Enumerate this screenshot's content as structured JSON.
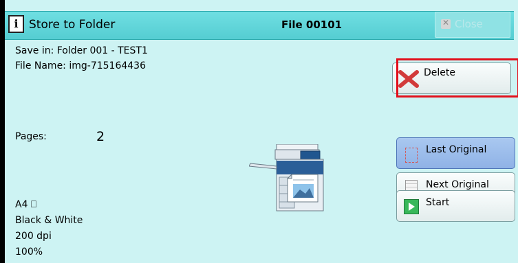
{
  "header": {
    "title": "Store to Folder",
    "file_number": "File 00101",
    "close_label": "Close"
  },
  "info": {
    "save_in": "Save in: Folder 001 - TEST1",
    "file_name": "File Name: img-715164436",
    "pages_label": "Pages:",
    "pages_value": "2"
  },
  "settings": {
    "paper": "A4 ⎕",
    "color": "Black & White",
    "resolution": "200 dpi",
    "scale": "100%"
  },
  "buttons": {
    "delete": "Delete",
    "last_original": "Last Original",
    "next_original": "Next Original",
    "start": "Start"
  },
  "colors": {
    "header": "#6fdfe2",
    "panel": "#cdf3f3",
    "selected_button": "#a9c8f0",
    "highlight": "#e20f1b"
  }
}
